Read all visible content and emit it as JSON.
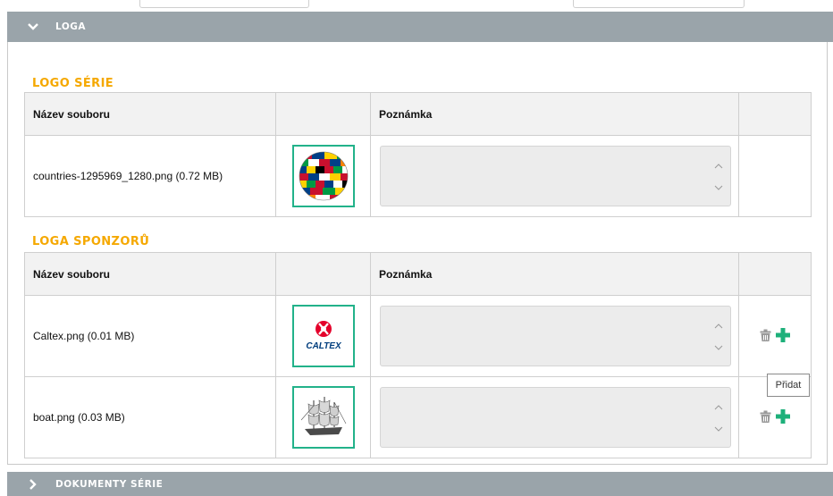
{
  "sections": {
    "logos": {
      "title": "LOGA"
    },
    "documents": {
      "title": "DOKUMENTY SÉRIE"
    }
  },
  "series_logo": {
    "title": "LOGO SÉRIE",
    "columns": {
      "file": "Název souboru",
      "note": "Poznámka"
    },
    "rows": [
      {
        "file": "countries-1295969_1280.png (0.72 MB)",
        "thumbnail": "globe-flags-image",
        "note": ""
      }
    ]
  },
  "sponsor_logos": {
    "title": "LOGA SPONZORŮ",
    "columns": {
      "file": "Název souboru",
      "note": "Poznámka"
    },
    "rows": [
      {
        "file": "Caltex.png (0.01 MB)",
        "thumbnail": "caltex-logo-image",
        "thumbnail_text": "CALTEX",
        "note": ""
      },
      {
        "file": "boat.png (0.03 MB)",
        "thumbnail": "sailing-ship-image",
        "note": ""
      }
    ]
  },
  "tooltip": {
    "text": "Přidat"
  },
  "icons": {
    "collapse": "chevron-down-icon",
    "expand": "chevron-right-icon",
    "delete": "trash-icon",
    "add": "plus-icon"
  },
  "colors": {
    "section_bar": "#9aa4aa",
    "group_title": "#f5a800",
    "thumb_border": "#22b28a",
    "add_icon": "#1db07a",
    "trash_icon": "#9a9a9a"
  }
}
